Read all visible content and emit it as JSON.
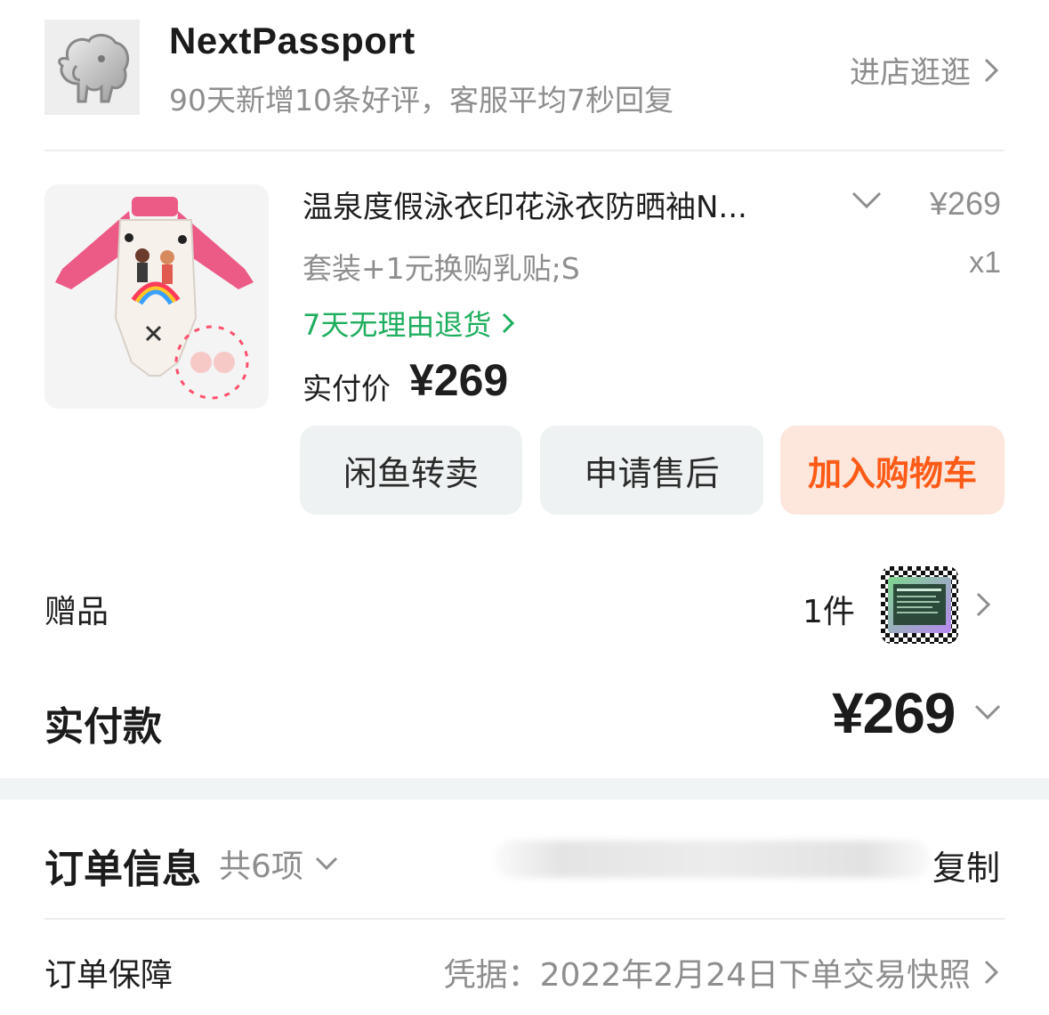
{
  "store": {
    "name": "NextPassport",
    "description": "90天新增10条好评，客服平均7秒回复",
    "enter_label": "进店逛逛"
  },
  "product": {
    "title": "温泉度假泳衣印花泳衣防晒袖N...",
    "price": "¥269",
    "spec": "套装+1元换购乳贴;S",
    "quantity": "x1",
    "return_policy": "7天无理由退货",
    "paid_label": "实付价",
    "paid_value": "¥269"
  },
  "actions": {
    "resell": "闲鱼转卖",
    "after_sale": "申请售后",
    "add_cart": "加入购物车"
  },
  "gift": {
    "label": "赠品",
    "count": "1件"
  },
  "total": {
    "label": "实付款",
    "value": "¥269"
  },
  "order_info": {
    "title": "订单信息",
    "count": "共6项",
    "copy_label": "复制"
  },
  "guarantee": {
    "label": "订单保障",
    "value": "凭据：2022年2月24日下单交易快照"
  },
  "colors": {
    "accent_green": "#1fae5e",
    "accent_orange": "#ff5a16",
    "muted": "#8e8e8e"
  }
}
